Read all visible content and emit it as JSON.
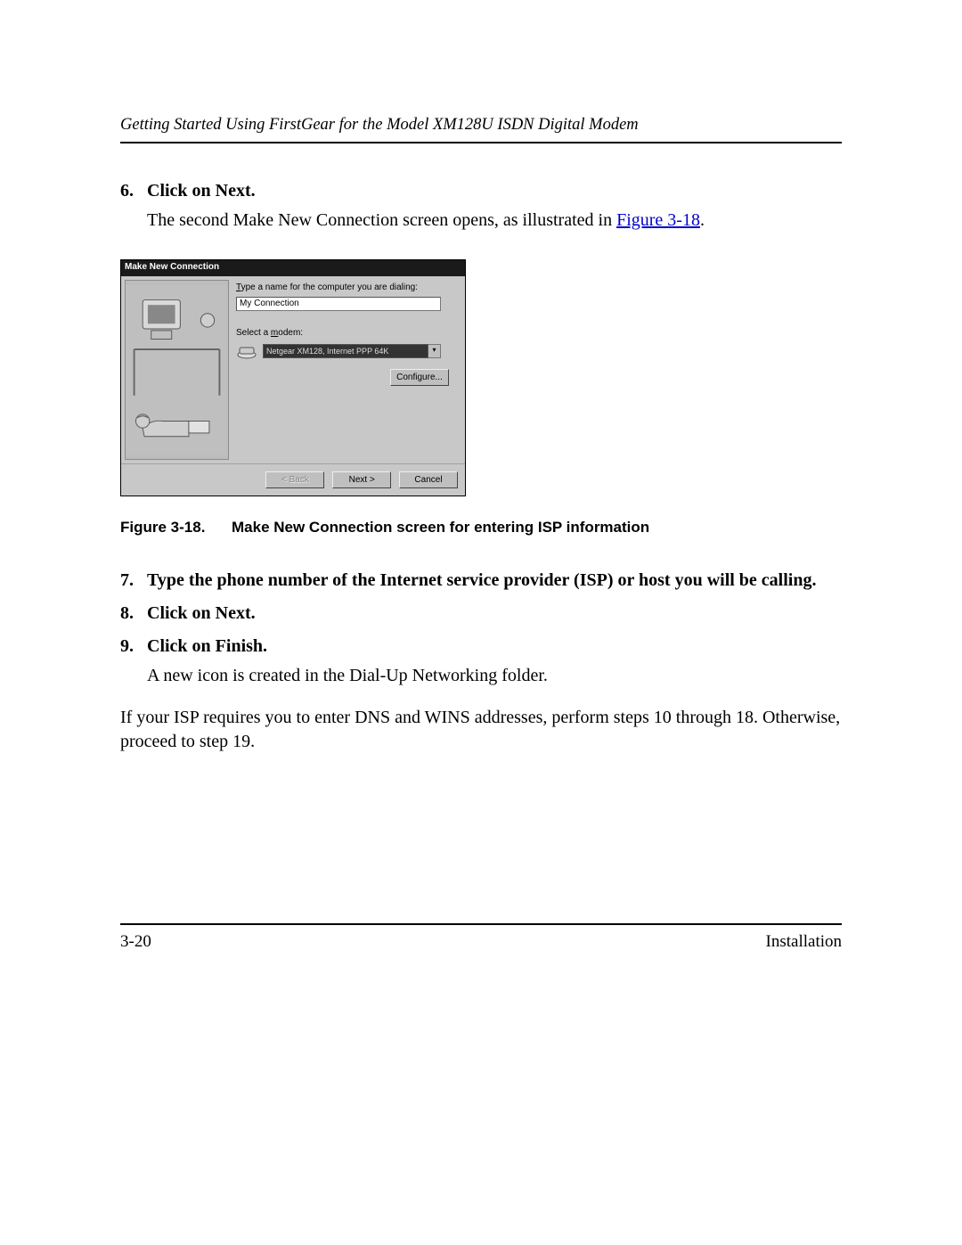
{
  "header": {
    "title": "Getting Started Using FirstGear for the Model XM128U ISDN Digital Modem"
  },
  "steps": {
    "s6": {
      "num": "6.",
      "title": "Click on Next.",
      "body_pre": "The second Make New Connection screen opens, as illustrated in ",
      "link": "Figure 3-18",
      "body_post": "."
    },
    "s7": {
      "num": "7.",
      "title": "Type the phone number of the Internet service provider (ISP) or host you will be calling."
    },
    "s8": {
      "num": "8.",
      "title": "Click on Next."
    },
    "s9": {
      "num": "9.",
      "title": "Click on Finish.",
      "body": "A new icon is created in the Dial-Up Networking folder."
    }
  },
  "dialog": {
    "title": "Make New Connection",
    "label_type": "Type a name for the computer you are dialing:",
    "name_value": "My Connection",
    "label_modem": "Select a modem:",
    "modem_value": "Netgear XM128, Internet PPP 64K",
    "configure": "Configure...",
    "back": "< Back",
    "next": "Next >",
    "cancel": "Cancel"
  },
  "caption": {
    "num": "Figure 3-18.",
    "text": "Make New Connection screen for entering ISP information"
  },
  "para": "If your ISP requires you to enter DNS and WINS addresses, perform steps 10 through 18. Otherwise, proceed to step 19.",
  "footer": {
    "page": "3-20",
    "section": "Installation"
  }
}
